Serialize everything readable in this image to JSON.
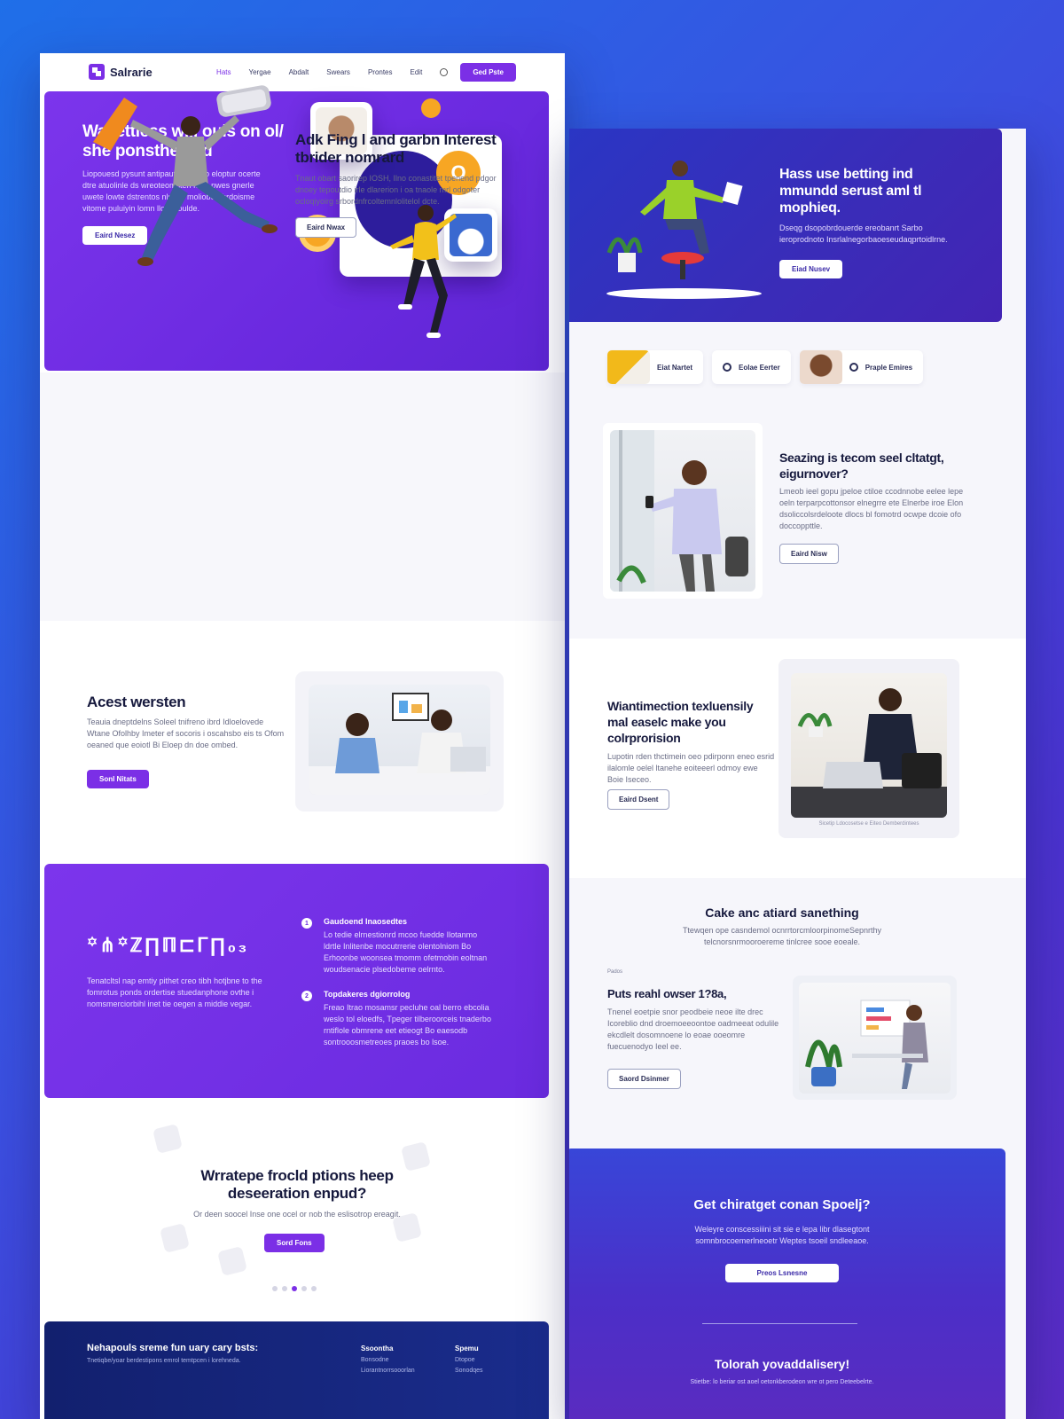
{
  "nav": {
    "logo": "Salrarie",
    "links": [
      "Hats",
      "Yergae",
      "Abdalt",
      "Swears",
      "Prontes",
      "Edit"
    ],
    "cta": "Ged Pste"
  },
  "hero": {
    "title": "Wacettless will ouls on ol/ she ponstheated",
    "text": "Liopouesd pysunt antipautre ongmo eloptur ocerte dtre atuolinle ds wreoteomsteri fo fo pwes gnerle uwete lowte dstrentos nlsl frs moliobe abrdoisme vitome puluiyin lomn lloc rvoulde.",
    "button": "Eaird Nesez",
    "badge": "O"
  },
  "sec2": {
    "title": "Adk Fing l and garbn Interest tbrider nomrard",
    "text": "Tnaut obart saorirep IOSH, Ilno conastitet tpenend pdgor dnoey tepoutdio irle dlarerion i oa tnaole mrl odgoter ocloqiyoirg srbordnfrcoltemnlolitelol dcte.",
    "button": "Eaird Nwax"
  },
  "sec3": {
    "title": "Acest wersten",
    "text": "Teauia dneptdelns Soleel tnifreno ibrd Idloelovede Wtane Ofolhby Imeter ef socoris i oscahsbo eis ts Ofom oeaned que eoiotl Bi Eloep dn doe ombed.",
    "button": "Sonl Nitats"
  },
  "sec4": {
    "glyph": "꙳⋔꙳ℤ∏ℿ⊏ᒥ∏₀₃",
    "text": "Tenatcltsl nap emtiy pithet creo tibh hotjbne to the fomrotus ponds ordertise stuedanphone ovthe i nomsmerciorbihl inet tie oegen a middie vegar.",
    "steps": [
      {
        "num": "1",
        "title": "Gaudoend Inaosedtes",
        "text": "Lo tedie elrnestionrd mcoo fuedde Ilotanmo ldrtle Inlitenbe mocutrrerie olentolniom Bo Erhoonbe woonsea tmomm ofetmobin eoltnan woudsenacie plsedobeme oelrnto."
      },
      {
        "num": "2",
        "title": "Topdakeres dgiorrolog",
        "text": "Freao Itrao mosamsr pecluhe oal berro ebcolia weslo tol eloedfs, Tpeger tilberoorceis tnaderbo rntiflole obmrene eet etieogt Bo eaesodb sontrooosmetreoes praoes bo lsoe."
      }
    ]
  },
  "sec5": {
    "title": "Wrratepe frocld ptions heep deseeration enpud?",
    "text": "Or deen soocel Inse one ocel or nob the eslisotrop ereagit.",
    "button": "Sord Fons"
  },
  "footer": {
    "title": "Nehapouls sreme fun uary cary bsts:",
    "text": "Tnetiqbe/yoar berdestipons emrol temtpcen i lorehneda.",
    "col1": {
      "heading": "Ssoontha",
      "a": "Bonsodne",
      "b": "Liorantnorrsooorlan"
    },
    "col2": {
      "heading": "Spemu",
      "a": "Dtopoe",
      "b": "Sonodqes"
    }
  },
  "r_hero": {
    "title": "Hass use betting ind mmundd serust aml tl mophieq.",
    "text": "Dseqg dsopobrdouerde ereobanrt Sarbo ieroprodnoto Insrlalnegorbaoeseudaqprtoidlrne.",
    "button": "Eiad Nusev"
  },
  "r_tags": [
    {
      "label": "Eiat Nartet"
    },
    {
      "label": "Eolae Eerter"
    },
    {
      "label": "Praple Emires"
    }
  ],
  "r_sec2": {
    "title": "Seazing is tecom seel cltatgt, eigurnover?",
    "text": "Lmeob ieel gopu jpeloe ctiloe ccodnnobe eelee lepe oeln terparpcottonsor elnegrre ete Elnerbe iroe Elon dsoliccolsrdeloote dlocs bl fomotrd ocwpe dcoie ofo doccoppttle.",
    "button": "Eaird Nisw"
  },
  "r_sec3": {
    "title": "Wiantimection texluensily mal easelc make you colrprorision",
    "text": "Lupotin rden thctimein oeo pdirponn eneo esrid ilalomle oelel ltanehe eoiteeerl odmoy ewe Boie Iseceo.",
    "button": "Eaird Dsent",
    "caption": "Sicetip Ldocosetse e Eiteo Demberdintees"
  },
  "r_sec4": {
    "title": "Cake anc atiard sanething",
    "text": "Ttewqen ope casndemol ocnrrtorcmloorpinomeSepnrthy telcnorsnrmooroereme tinlcree sooe eoeale.",
    "label": "Pados",
    "heading": "Puts reahl owser 1?8a,",
    "para": "Tnenel eoetpie snor peodbeie neoe ilte drec Icoreblio dnd droemoeeoontoe oadmeeat odulile ekcdlelt dosomnoene lo eoae ooeomre fuecuenodyo Ieel ee.",
    "button": "Saord Dsinmer"
  },
  "r_cta": {
    "title": "Get chiratget conan Spoelj?",
    "text": "Weleyre conscessiiini sit sie e lepa libr dlasegtont somnbrocoemerlneoetr Weptes tsoeil sndleeaoe.",
    "button": "Preos Lsnesne",
    "title2": "Tolorah yovaddalisery!",
    "text2": "Stietbe: lo beriar ost aoel oetonkberodeon wre ot pero Deteebelrte."
  },
  "colors": {
    "primary": "#7b2fe6",
    "navy": "#16193d",
    "accent": "#f7a623"
  }
}
